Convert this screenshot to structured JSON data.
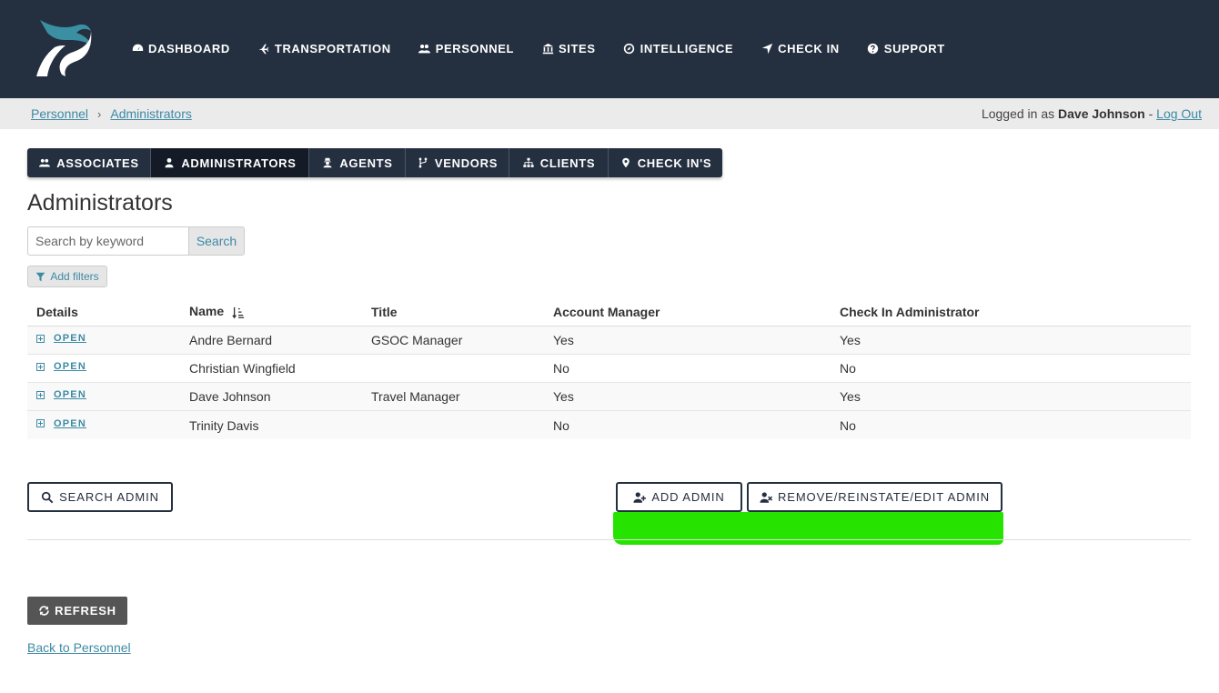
{
  "brand": {
    "logo_icon": "p-wave-logo-icon",
    "colors": {
      "teal": "#3b8fa3",
      "navy": "#242f40",
      "accent_green": "#27e300"
    }
  },
  "nav": {
    "items": [
      {
        "label": "DASHBOARD",
        "icon": "gauge-icon"
      },
      {
        "label": "TRANSPORTATION",
        "icon": "plane-icon"
      },
      {
        "label": "PERSONNEL",
        "icon": "users-icon"
      },
      {
        "label": "SITES",
        "icon": "bank-icon"
      },
      {
        "label": "INTELLIGENCE",
        "icon": "compass-icon"
      },
      {
        "label": "CHECK IN",
        "icon": "location-arrow-icon"
      },
      {
        "label": "SUPPORT",
        "icon": "question-circle-icon"
      }
    ]
  },
  "breadcrumb": {
    "items": [
      "Personnel",
      "Administrators"
    ],
    "separator": "›"
  },
  "session": {
    "prefix": "Logged in as",
    "user": "Dave Johnson",
    "dash": "-",
    "logout": "Log Out"
  },
  "tabs": [
    {
      "label": "ASSOCIATES",
      "icon": "users-icon",
      "active": false
    },
    {
      "label": "ADMINISTRATORS",
      "icon": "user-icon",
      "active": true
    },
    {
      "label": "AGENTS",
      "icon": "user-secret-icon",
      "active": false
    },
    {
      "label": "VENDORS",
      "icon": "code-fork-icon",
      "active": false
    },
    {
      "label": "CLIENTS",
      "icon": "sitemap-icon",
      "active": false
    },
    {
      "label": "CHECK IN'S",
      "icon": "map-marker-icon",
      "active": false
    }
  ],
  "page": {
    "title": "Administrators"
  },
  "search": {
    "placeholder": "Search by keyword",
    "button": "Search",
    "filters": "Add filters"
  },
  "table": {
    "columns": [
      "Details",
      "Name",
      "Title",
      "Account Manager",
      "Check In Administrator"
    ],
    "rows": [
      {
        "open": "OPEN",
        "name": "Andre Bernard",
        "title": "GSOC Manager",
        "account_manager": "Yes",
        "checkin_admin": "Yes"
      },
      {
        "open": "OPEN",
        "name": "Christian Wingfield",
        "title": "",
        "account_manager": "No",
        "checkin_admin": "No"
      },
      {
        "open": "OPEN",
        "name": "Dave Johnson",
        "title": "Travel Manager",
        "account_manager": "Yes",
        "checkin_admin": "Yes"
      },
      {
        "open": "OPEN",
        "name": "Trinity Davis",
        "title": "",
        "account_manager": "No",
        "checkin_admin": "No"
      }
    ]
  },
  "actions": {
    "search_admin": "SEARCH ADMIN",
    "add_admin": "ADD ADMIN",
    "edit_admin": "REMOVE/REINSTATE/EDIT ADMIN",
    "refresh": "REFRESH",
    "back": "Back to Personnel"
  }
}
